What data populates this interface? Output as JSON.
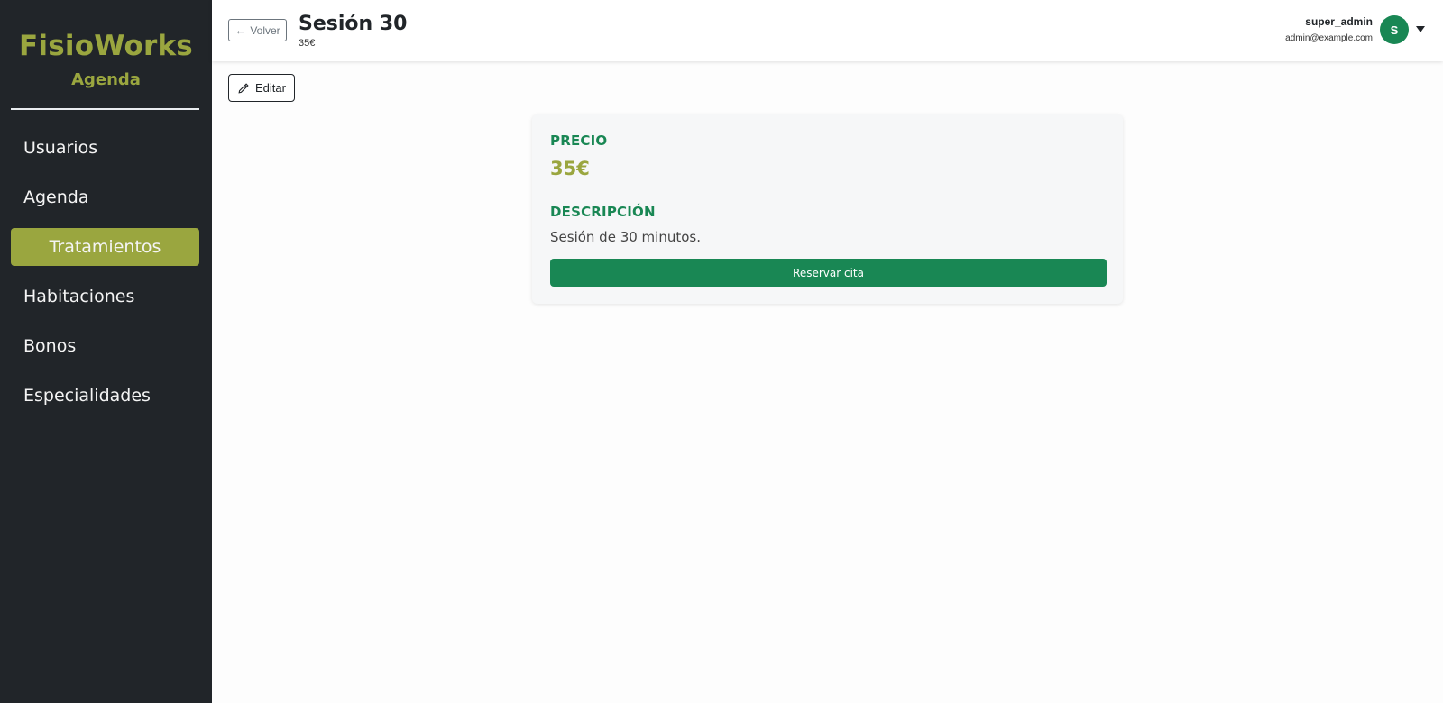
{
  "sidebar": {
    "brand_title": "FisioWorks",
    "brand_subtitle": "Agenda",
    "items": [
      {
        "label": "Usuarios",
        "active": false
      },
      {
        "label": "Agenda",
        "active": false
      },
      {
        "label": "Tratamientos",
        "active": true
      },
      {
        "label": "Habitaciones",
        "active": false
      },
      {
        "label": "Bonos",
        "active": false
      },
      {
        "label": "Especialidades",
        "active": false
      }
    ]
  },
  "header": {
    "back_label": "Volver",
    "back_icon": "arrow-left-icon",
    "title": "Sesión 30",
    "subtitle": "35€",
    "user_name": "super_admin",
    "user_email": "admin@example.com",
    "avatar_initial": "S",
    "menu_icon": "caret-down-icon"
  },
  "toolbar": {
    "edit_label": "Editar",
    "edit_icon": "pencil-icon"
  },
  "detail": {
    "price_label": "PRECIO",
    "price_value": "35€",
    "description_label": "DESCRIPCIÓN",
    "description_text": "Sesión de 30 minutos.",
    "book_label": "Reservar cita"
  },
  "colors": {
    "sidebar_bg": "#212529",
    "brand": "#9aa63f",
    "accent_green": "#198754",
    "card_bg": "#f6f7f8"
  }
}
